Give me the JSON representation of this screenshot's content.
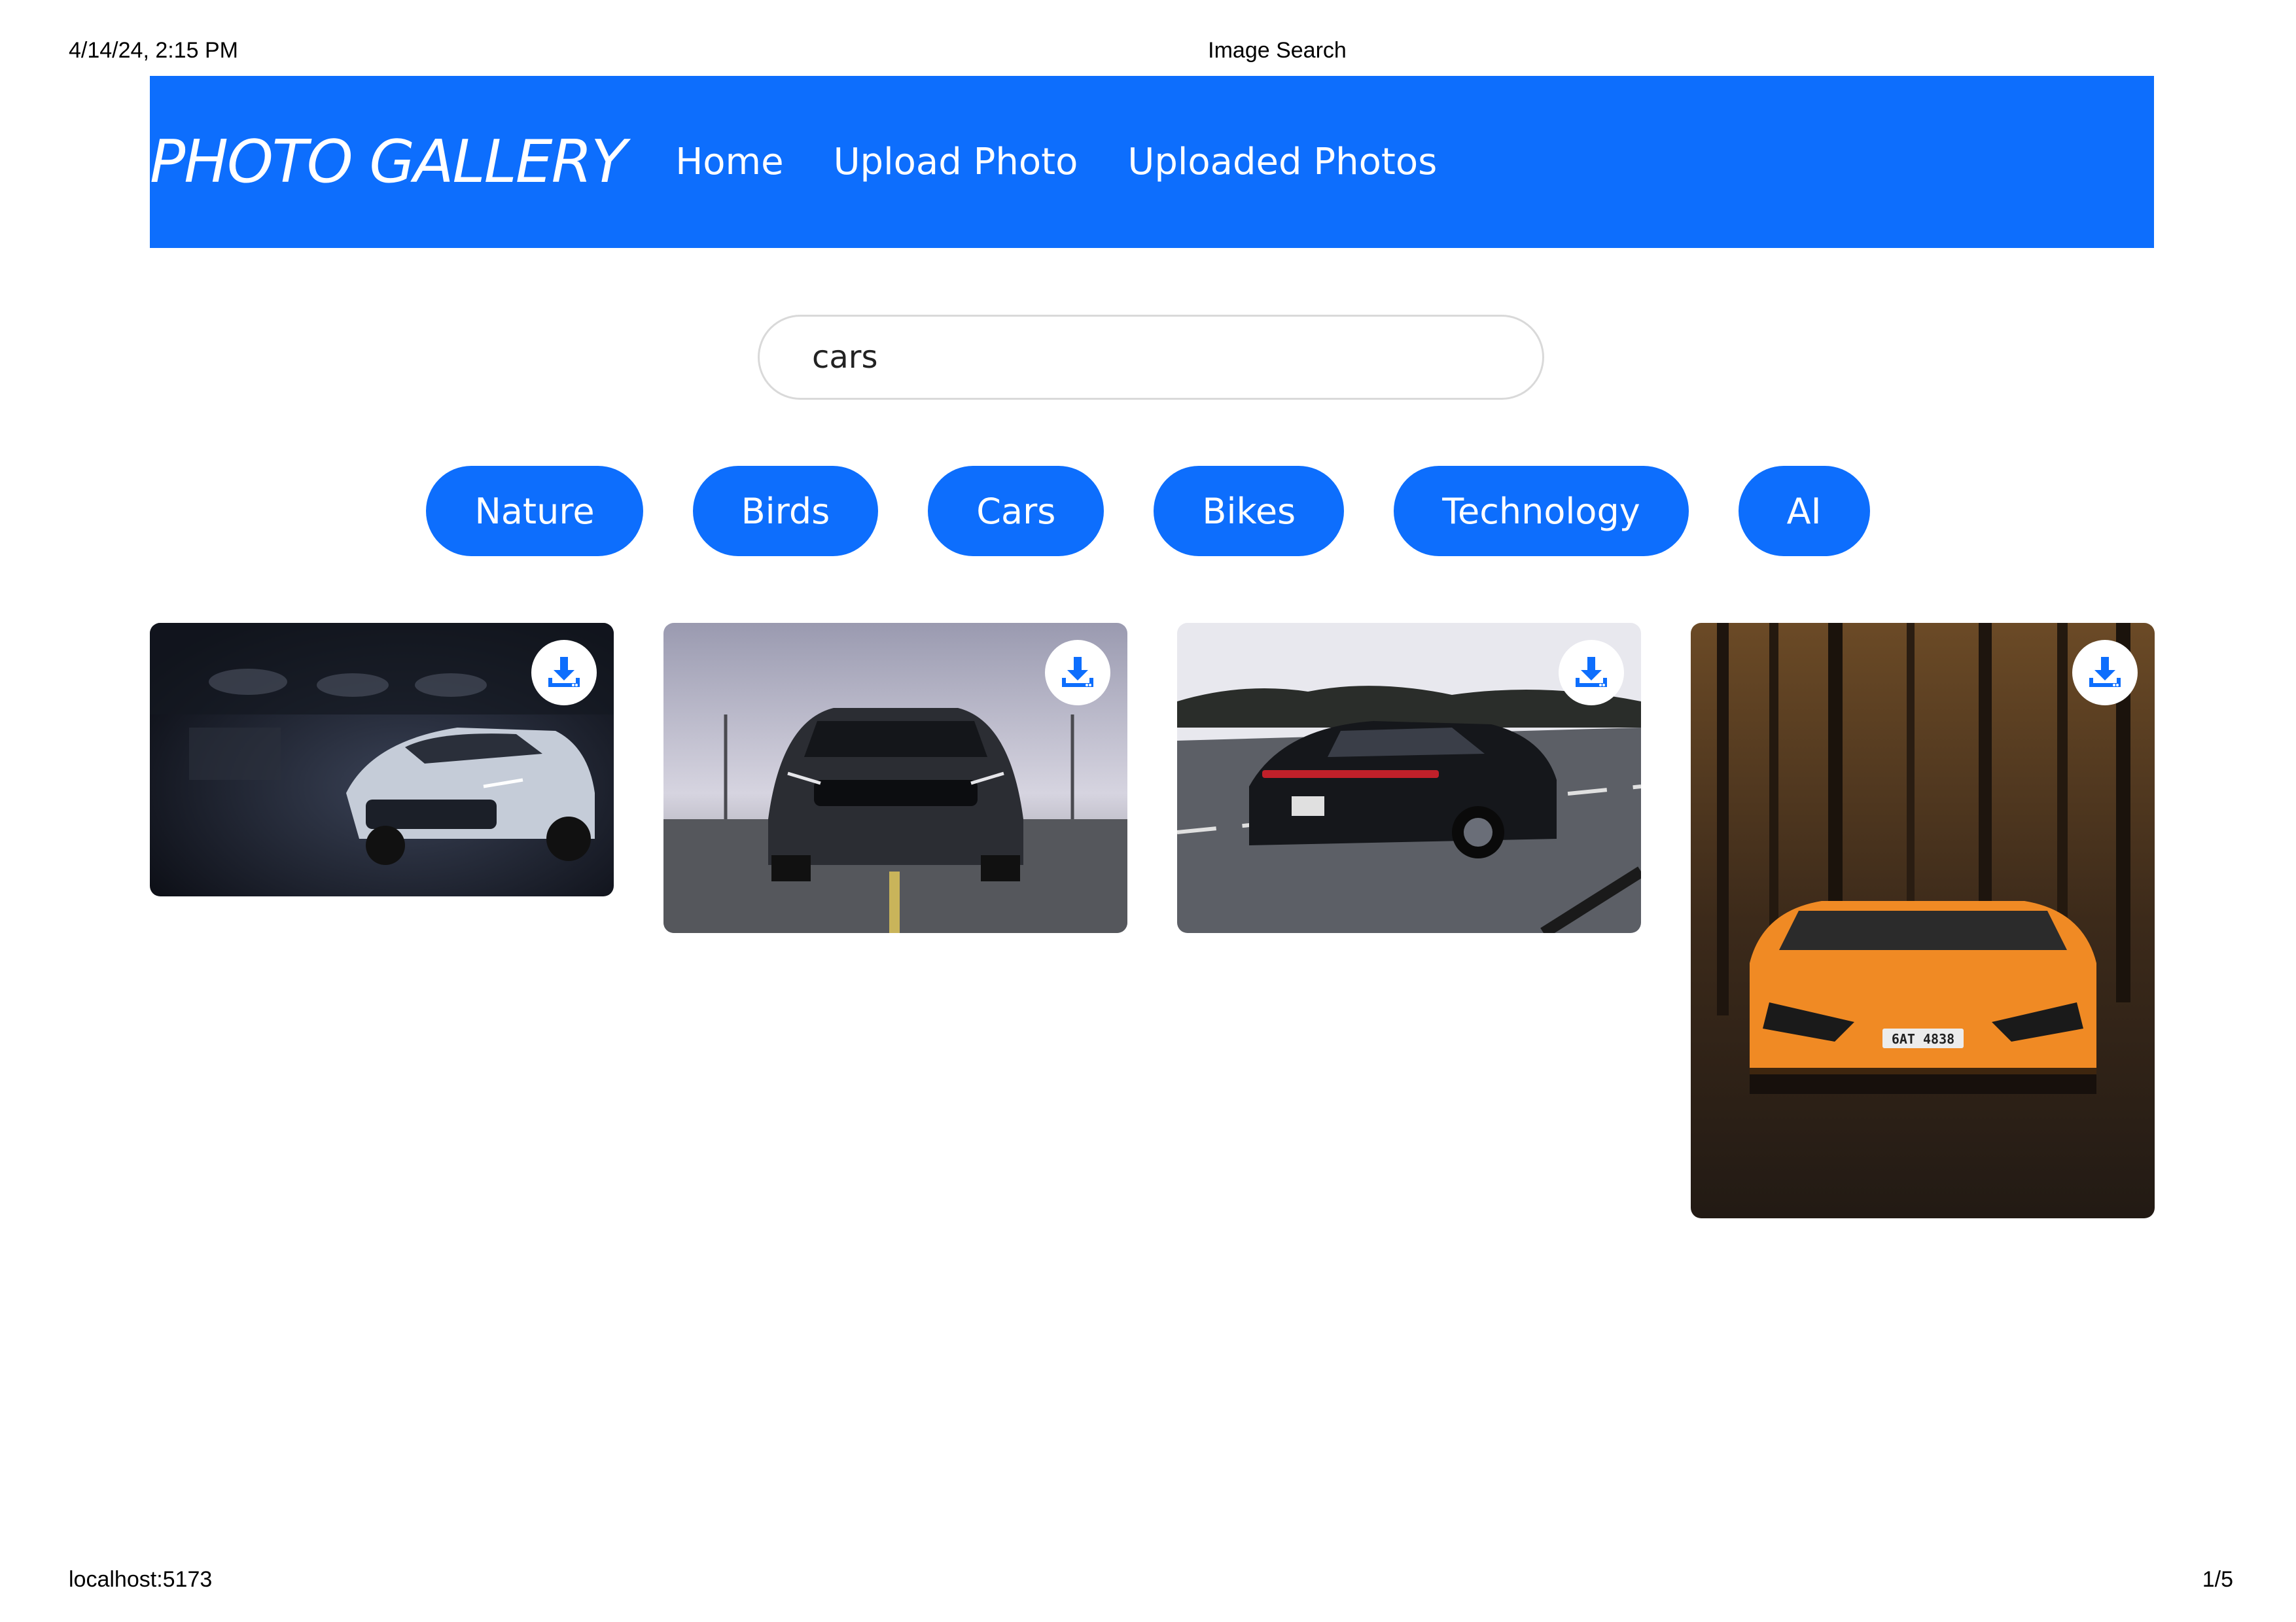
{
  "print_header": {
    "date": "4/14/24, 2:15 PM",
    "title": "Image Search"
  },
  "print_footer": {
    "url": "localhost:5173",
    "page": "1/5"
  },
  "navbar": {
    "brand": "PHOTO GALLERY",
    "links": [
      "Home",
      "Upload Photo",
      "Uploaded Photos"
    ],
    "color": "#0d6efd"
  },
  "search": {
    "value": "cars"
  },
  "categories": [
    "Nature",
    "Birds",
    "Cars",
    "Bikes",
    "Technology",
    "AI"
  ],
  "gallery": {
    "photos": [
      {
        "subject": "white sports car in dark garage",
        "icon": "download-icon"
      },
      {
        "subject": "dark grey muscle car on rooftop",
        "icon": "download-icon"
      },
      {
        "subject": "black sedan driving on highway",
        "icon": "download-icon"
      },
      {
        "subject": "orange supercar in forest",
        "icon": "download-icon",
        "plate": "6AT 4838"
      }
    ]
  }
}
